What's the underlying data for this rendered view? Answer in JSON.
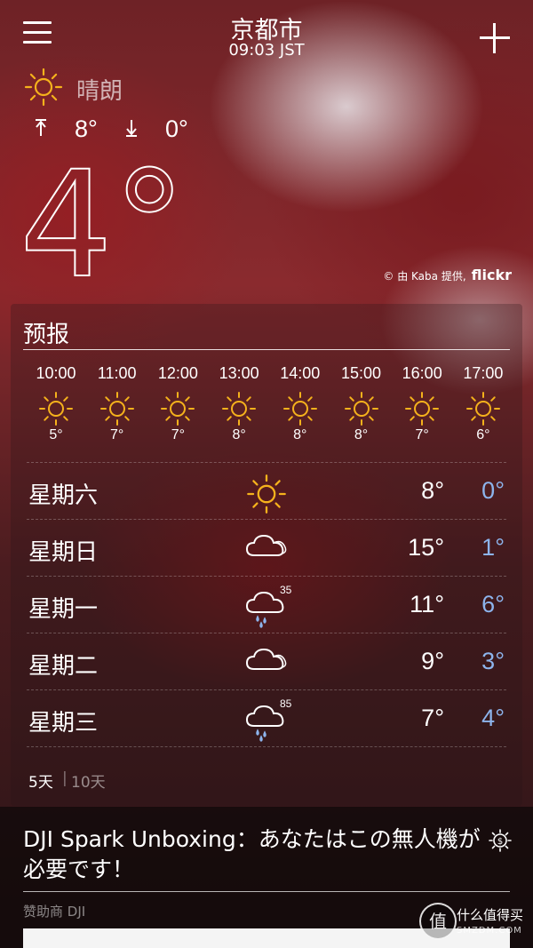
{
  "header": {
    "city": "京都市",
    "time": "09:03 JST"
  },
  "current": {
    "condition": "晴朗",
    "condition_icon": "sun-icon",
    "high": "8°",
    "low": "0°",
    "temp": "4°"
  },
  "photo_credit": {
    "text": "© 由 Kaba 提供,",
    "brand": "flickr"
  },
  "forecast": {
    "title": "预报",
    "hourly": [
      {
        "time": "10:00",
        "icon": "sun-icon",
        "temp": "5°"
      },
      {
        "time": "11:00",
        "icon": "sun-icon",
        "temp": "7°"
      },
      {
        "time": "12:00",
        "icon": "sun-icon",
        "temp": "7°"
      },
      {
        "time": "13:00",
        "icon": "sun-icon",
        "temp": "8°"
      },
      {
        "time": "14:00",
        "icon": "sun-icon",
        "temp": "8°"
      },
      {
        "time": "15:00",
        "icon": "sun-icon",
        "temp": "8°"
      },
      {
        "time": "16:00",
        "icon": "sun-icon",
        "temp": "7°"
      },
      {
        "time": "17:00",
        "icon": "sun-icon",
        "temp": "6°"
      }
    ],
    "daily": [
      {
        "day": "星期六",
        "icon": "sun-icon",
        "precip": "",
        "high": "8°",
        "low": "0°"
      },
      {
        "day": "星期日",
        "icon": "cloud-icon",
        "precip": "",
        "high": "15°",
        "low": "1°"
      },
      {
        "day": "星期一",
        "icon": "rain-cloud-icon",
        "precip": "35",
        "high": "11°",
        "low": "6°"
      },
      {
        "day": "星期二",
        "icon": "cloud-icon",
        "precip": "",
        "high": "9°",
        "low": "3°"
      },
      {
        "day": "星期三",
        "icon": "rain-cloud-icon",
        "precip": "85",
        "high": "7°",
        "low": "4°"
      }
    ],
    "tabs": {
      "five_day": "5天",
      "separator": "|",
      "ten_day": "10天"
    }
  },
  "ad": {
    "title": "DJI Spark Unboxing：あなたはこの無人機が必要です！",
    "sponsor": "赞助商 DJI"
  },
  "watermark": {
    "logo": "值",
    "text": "什么值得买",
    "sub": "SMZDM.COM"
  },
  "colors": {
    "sun": "#f5b21c",
    "low_temp": "#8db4ec",
    "rain": "#8db4ec"
  }
}
